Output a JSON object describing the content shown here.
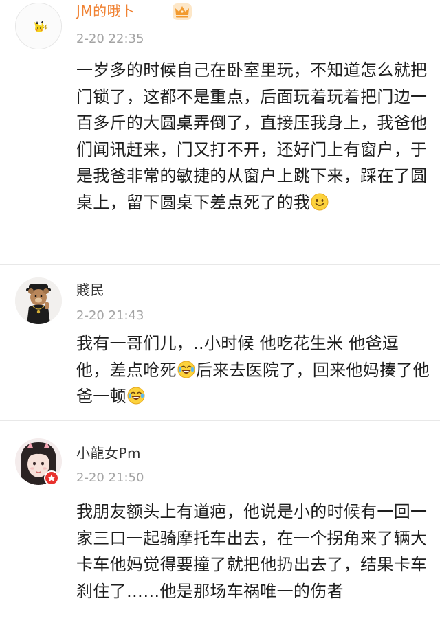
{
  "comments": [
    {
      "username": "JM的哦卜",
      "time": "2-20 22:35",
      "badge_icon": "crown-icon",
      "text": "一岁多的时候自己在卧室里玩，不知道怎么就把门锁了，这都不是重点，后面玩着玩着把门边一百多斤的大圆桌弄倒了，直接压我身上，我爸他们闻讯赶来，门又打不开，还好门上有窗户，于是我爸非常的敏捷的从窗户上跳下来，踩在了圆桌上，留下圆桌下差点死了的我",
      "trailing_emoji": "smile-emoji"
    },
    {
      "username": "賤民",
      "time": "2-20 21:43",
      "text_part1": "我有一哥们儿，..小时候 他吃花生米 他爸逗他，差点呛死",
      "text_part2": "后来去医院了，回来他妈揍了他爸一顿",
      "emoji": "laugh-cry-emoji"
    },
    {
      "username": "小龍女Pm",
      "time": "2-20 21:50",
      "badge_icon": "verified-badge-icon",
      "text": "我朋友额头上有道疤，他说是小的时候有一回一家三口一起骑摩托车出去，在一个拐角来了辆大卡车他妈觉得要撞了就把他扔出去了，结果卡车刹住了……他是那场车祸唯一的伤者"
    }
  ],
  "colors": {
    "vip_name": "#f08233",
    "name": "#333333",
    "time": "#a3a3a3",
    "text": "#1e1e1e",
    "divider": "#e8e8e8"
  }
}
